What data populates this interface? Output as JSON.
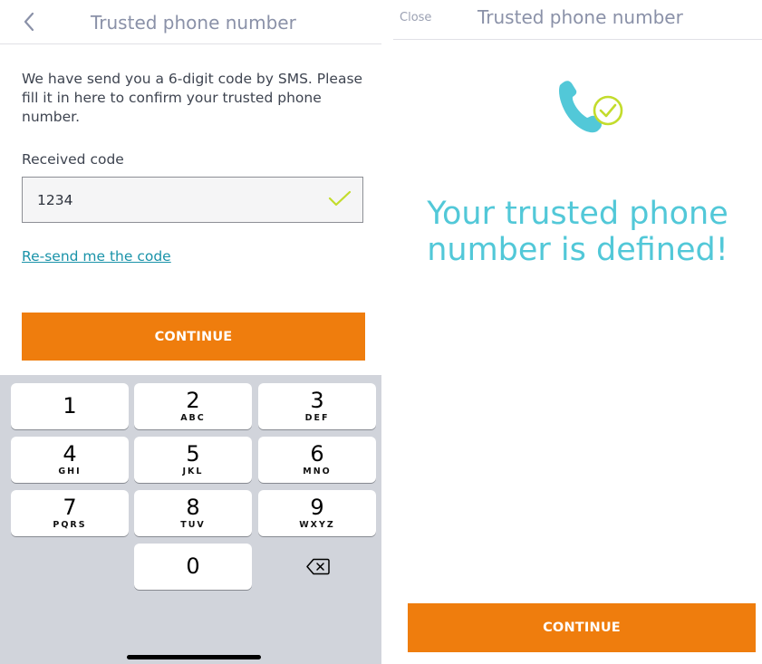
{
  "left_screen": {
    "header": {
      "title": "Trusted phone number",
      "back_icon": "chevron-left-icon"
    },
    "intro": "We have send you a 6-digit code by SMS. Please fill it in here to confirm your trusted phone number.",
    "code_field": {
      "label": "Received code",
      "value": "1234",
      "valid_icon": "checkmark-icon"
    },
    "resend_link": "Re-send me the code",
    "continue_label": "CONTINUE",
    "keypad": {
      "keys": [
        {
          "digit": "1",
          "letters": ""
        },
        {
          "digit": "2",
          "letters": "ABC"
        },
        {
          "digit": "3",
          "letters": "DEF"
        },
        {
          "digit": "4",
          "letters": "GHI"
        },
        {
          "digit": "5",
          "letters": "JKL"
        },
        {
          "digit": "6",
          "letters": "MNO"
        },
        {
          "digit": "7",
          "letters": "PQRS"
        },
        {
          "digit": "8",
          "letters": "TUV"
        },
        {
          "digit": "9",
          "letters": "WXYZ"
        },
        {
          "digit": "0",
          "letters": ""
        }
      ],
      "delete_icon": "backspace-icon"
    }
  },
  "right_screen": {
    "header": {
      "close_label": "Close",
      "title": "Trusted phone number"
    },
    "illustration_icon": "phone-check-icon",
    "success_message": "Your trusted phone number is defined!",
    "continue_label": "CONTINUE"
  },
  "colors": {
    "accent_orange": "#ef7d0d",
    "teal": "#52c8d8",
    "link_teal": "#1a93a9",
    "check_lime": "#c3dc2c",
    "title_gray": "#8a91a8",
    "keyboard_bg": "#d1d4db"
  }
}
